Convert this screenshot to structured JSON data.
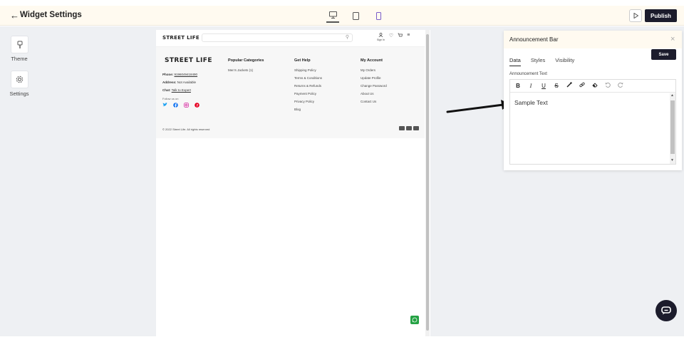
{
  "header": {
    "back_glyph": "←",
    "title": "Widget Settings",
    "publish_label": "Publish"
  },
  "left_tools": [
    {
      "label": "Theme",
      "icon": "paint-brush-icon"
    },
    {
      "label": "Settings",
      "icon": "gear-icon"
    }
  ],
  "preview": {
    "brand": "STREET LIFE",
    "nav_signin": "Sign In",
    "footer": {
      "brand": "STREET LIFE",
      "phone_label": "Phone:",
      "phone_value": "9196049418490",
      "address_label": "Address:",
      "address_value": "Not Available",
      "chat_label": "Chat:",
      "chat_value": "Talk to Expert",
      "follow": "Follow us on",
      "columns": [
        {
          "heading": "Popular Categories",
          "items": [
            "Men's Jackets (1)"
          ]
        },
        {
          "heading": "Get Help",
          "items": [
            "Shipping Policy",
            "Terms & Conditions",
            "Returns & Refunds",
            "Payment Policy",
            "Privacy Policy",
            "Blog"
          ]
        },
        {
          "heading": "My Account",
          "items": [
            "My Orders",
            "Update Profile",
            "Change Password",
            "About Us",
            "Contact Us"
          ]
        }
      ],
      "copyright": "© 2022 Street Life. All rights reserved"
    }
  },
  "panel": {
    "title": "Announcement Bar",
    "save_label": "Save",
    "tabs": [
      "Data",
      "Styles",
      "Visibility"
    ],
    "active_tab": "Data",
    "field_label": "Announcement Text",
    "toolbar": {
      "bold": "B",
      "italic": "I",
      "underline": "U",
      "strike": "S"
    },
    "editor_value": "Sample Text"
  },
  "colors": {
    "topbar_bg": "#fffaf0",
    "primary_dark": "#1c1c2c",
    "canvas_bg": "#eef0f3",
    "whatsapp": "#25a244"
  }
}
